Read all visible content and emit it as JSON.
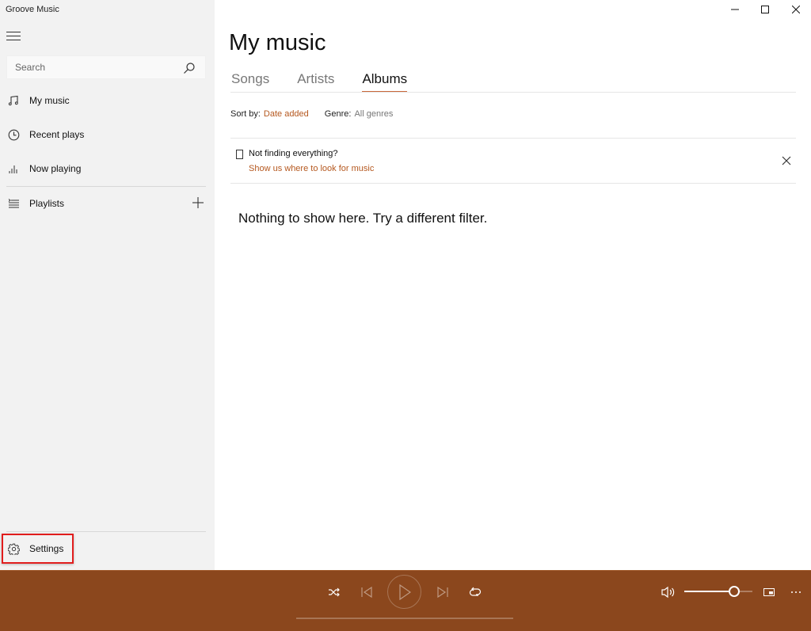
{
  "app": {
    "title": "Groove Music"
  },
  "sidebar": {
    "search_placeholder": "Search",
    "items": [
      {
        "label": "My music",
        "icon": "music-note-icon"
      },
      {
        "label": "Recent plays",
        "icon": "clock-icon"
      },
      {
        "label": "Now playing",
        "icon": "equalizer-icon"
      },
      {
        "label": "Playlists",
        "icon": "playlist-icon"
      }
    ],
    "settings_label": "Settings"
  },
  "main": {
    "title": "My music",
    "tabs": [
      {
        "label": "Songs",
        "active": false
      },
      {
        "label": "Artists",
        "active": false
      },
      {
        "label": "Albums",
        "active": true
      }
    ],
    "sort_label": "Sort by:",
    "sort_value": "Date added",
    "genre_label": "Genre:",
    "genre_value": "All genres",
    "banner": {
      "title": "Not finding everything?",
      "link": "Show us where to look for music"
    },
    "empty_message": "Nothing to show here. Try a different filter."
  },
  "player": {
    "volume_percent": 73,
    "progress_percent": 0
  },
  "colors": {
    "accent": "#b5581f",
    "player_bg": "#8b471d",
    "tab_underline": "#c8673a",
    "highlight_box": "#e11d1d"
  }
}
